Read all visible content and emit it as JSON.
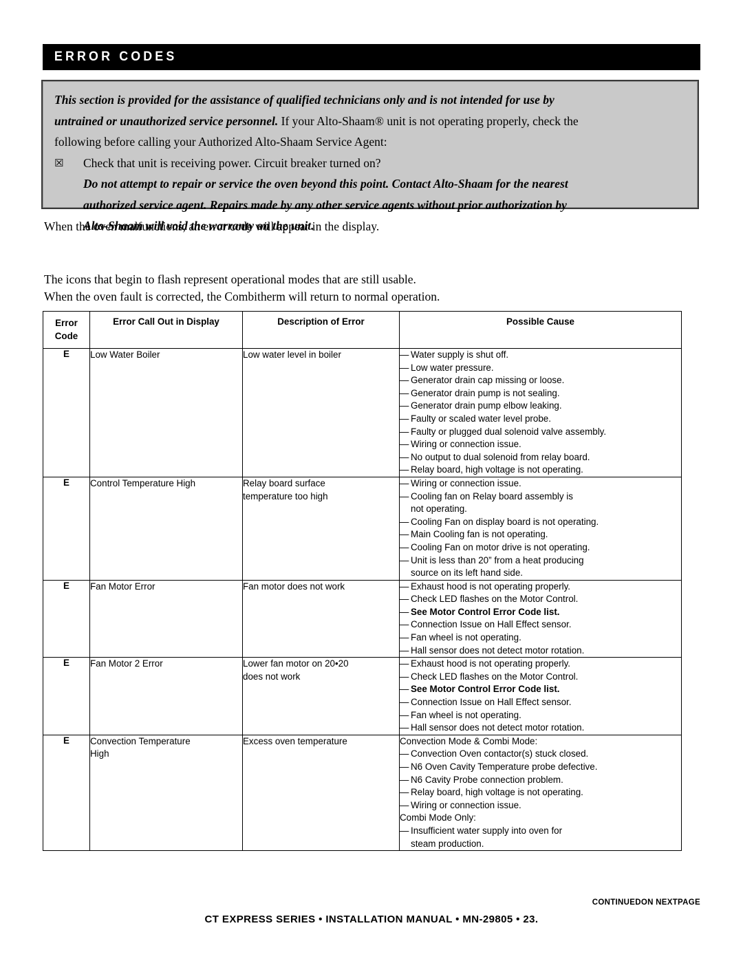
{
  "section": {
    "title": "ERROR CODES"
  },
  "notice": {
    "line1": "This section is provided for the assistance of qualified technicians only and is not intended for use by",
    "line2_italic": "untrained or unauthorized service personnel.",
    "line2_roman": " If your Alto-Shaam® unit is not operating properly, check the",
    "line3": "following before calling your Authorized Alto-Shaam Service Agent:",
    "bullet_glyph": "☒",
    "bullet_text": "Check that unit is receiving power. Circuit breaker turned on?",
    "warn1": "Do not attempt to repair or service the oven beyond this point. Contact Alto-Shaam for the nearest",
    "warn2": "authorized service agent. Repairs made by any other service agents without prior authorization by",
    "warn3": "Alto-Shaam will void the warranty on the unit."
  },
  "intro": {
    "para1": "When the oven malfunctions, an error code will appear in the display.",
    "para2": "The icons that begin to flash represent operational modes that are still usable.",
    "para3": "When the oven fault is corrected, the Combitherm will return to normal operation."
  },
  "table": {
    "headers": {
      "code_line1": "Error",
      "code_line2": "Code",
      "callout": "Error Call Out in Display",
      "description": "Description of Error",
      "cause": "Possible Cause"
    },
    "rows": [
      {
        "code": "E",
        "callout": [
          "Low Water Boiler"
        ],
        "description": [
          "Low water level in boiler"
        ],
        "causes": [
          {
            "dash": "—",
            "text": "Water supply is shut off."
          },
          {
            "dash": "—",
            "text": "Low water pressure."
          },
          {
            "dash": "—",
            "text": "Generator drain cap missing or loose."
          },
          {
            "dash": "—",
            "text": "Generator drain pump is not sealing."
          },
          {
            "dash": "—",
            "text": "Generator drain pump elbow leaking."
          },
          {
            "dash": "—",
            "text": "Faulty or scaled water level probe."
          },
          {
            "dash": "—",
            "text": "Faulty or plugged dual solenoid valve assembly."
          },
          {
            "dash": "—",
            "text": "Wiring or connection issue."
          },
          {
            "dash": "—",
            "text": "No output to dual solenoid from relay board."
          },
          {
            "dash": "—",
            "text": "Relay board, high voltage is not operating."
          }
        ]
      },
      {
        "code": "E",
        "callout": [
          "Control Temperature High"
        ],
        "description": [
          "Relay board surface",
          "temperature too high"
        ],
        "causes": [
          {
            "dash": "—",
            "text": "Wiring or connection issue."
          },
          {
            "dash": "—",
            "text": "Cooling fan on Relay board assembly is",
            "cont": "not operating."
          },
          {
            "dash": "—",
            "text": "Cooling Fan on display board is not operating."
          },
          {
            "dash": "—",
            "text": "Main Cooling fan is not operating."
          },
          {
            "dash": "—",
            "text": "Cooling Fan on motor drive is not operating."
          },
          {
            "dash": "—",
            "text": "Unit is less than 20” from a heat producing",
            "cont": "source on its left hand side."
          }
        ]
      },
      {
        "code": "E",
        "callout": [
          "Fan Motor Error"
        ],
        "description": [
          "Fan motor does not work"
        ],
        "causes": [
          {
            "dash": "—",
            "text": "Exhaust hood is not operating properly."
          },
          {
            "dash": "—",
            "text": "Check LED flashes on the Motor Control."
          },
          {
            "dash": "—",
            "text": "See Motor Control Error Code list.",
            "bold": true
          },
          {
            "dash": "—",
            "text": "Connection Issue on Hall Effect sensor."
          },
          {
            "dash": "—",
            "text": "Fan wheel is not operating."
          },
          {
            "dash": "—",
            "text": "Hall sensor does not detect motor rotation."
          }
        ]
      },
      {
        "code": "E",
        "callout": [
          "Fan Motor 2 Error"
        ],
        "description": [
          "Lower fan motor on 20•20",
          "does not work"
        ],
        "causes": [
          {
            "dash": "—",
            "text": "Exhaust hood is not operating properly."
          },
          {
            "dash": "—",
            "text": "Check LED flashes on the Motor Control."
          },
          {
            "dash": "—",
            "text": "See Motor Control Error Code list.",
            "bold": true
          },
          {
            "dash": "—",
            "text": "Connection Issue on Hall Effect sensor."
          },
          {
            "dash": "—",
            "text": "Fan wheel is not operating."
          },
          {
            "dash": "—",
            "text": "Hall sensor does not detect motor rotation."
          }
        ]
      },
      {
        "code": "E",
        "callout": [
          "Convection Temperature",
          "High"
        ],
        "description": [
          "Excess oven temperature"
        ],
        "causes": [
          {
            "head": "Convection Mode & Combi Mode:"
          },
          {
            "dash": "—",
            "text": "Convection Oven contactor(s) stuck closed."
          },
          {
            "dash": "—",
            "text": "N6 Oven Cavity Temperature probe defective."
          },
          {
            "dash": "—",
            "text": "N6 Cavity Probe connection problem."
          },
          {
            "dash": "—",
            "text": "Relay board, high voltage is not operating."
          },
          {
            "dash": "—",
            "text": "Wiring or connection issue."
          },
          {
            "head": "Combi Mode Only:"
          },
          {
            "dash": "—",
            "text": "Insufficient water supply into oven for",
            "cont": "steam production."
          }
        ]
      }
    ]
  },
  "footer": {
    "continued": "CONTINUEDON NEXTPAGE",
    "line": "CT EXPRESS SERIES • INSTALLATION MANUAL •  MN-29805 • 23."
  }
}
